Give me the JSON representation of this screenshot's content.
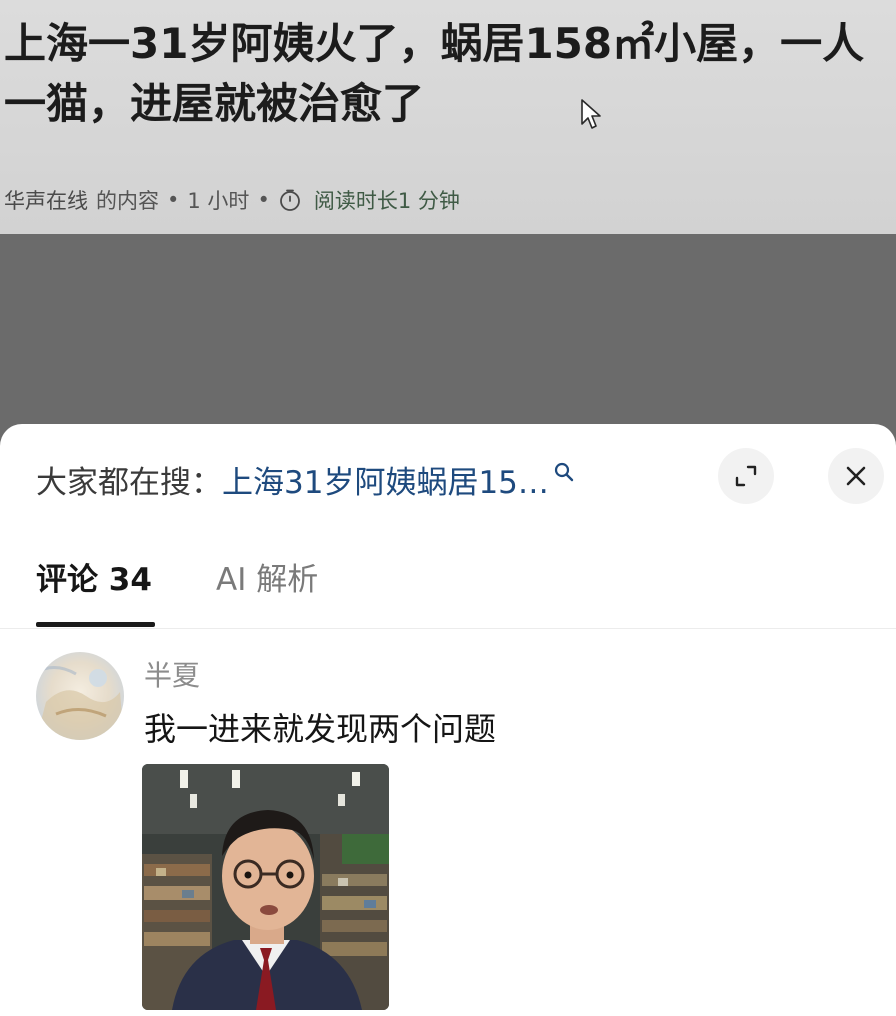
{
  "article": {
    "title": "上海一31岁阿姨火了，蜗居158㎡小屋，一人一猫，进屋就被治愈了",
    "source": "华声在线",
    "source_suffix": "的内容",
    "dot": "•",
    "time_ago": "1 小时",
    "read_time": "阅读时长1 分钟"
  },
  "search_bar": {
    "prefix": "大家都在搜：",
    "query": "上海31岁阿姨蜗居15…"
  },
  "tabs": [
    {
      "label": "评论 34",
      "active": true
    },
    {
      "label": "AI 解析",
      "active": false
    }
  ],
  "comments": [
    {
      "username": "半夏",
      "text": "我一进来就发现两个问题"
    }
  ],
  "icons": {
    "timer": "timer-icon",
    "search": "search-icon",
    "expand": "expand-icon",
    "close": "close-icon",
    "cursor": "mouse-cursor-icon"
  },
  "colors": {
    "link_blue": "#1e4a7e",
    "read_time_green": "#3f5a45",
    "overlay_gray": "#6b6b6b"
  }
}
